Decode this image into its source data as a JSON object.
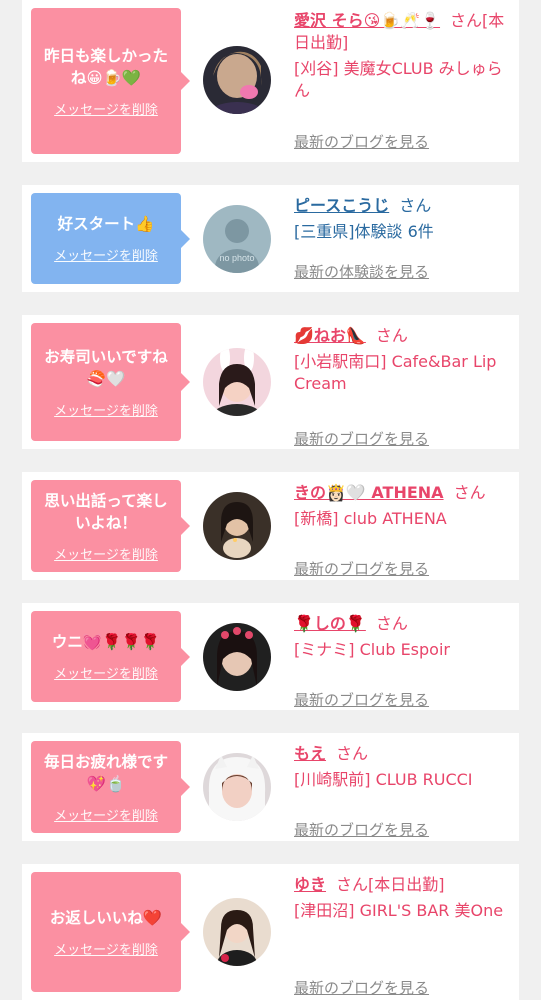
{
  "colors": {
    "pink_bubble": "#fb90a2",
    "blue_bubble": "#82b4f0",
    "pink_text": "#e8456a",
    "blue_text": "#2a6aa0",
    "link_gray": "#8a8a8a"
  },
  "delete_label": "メッセージを削除",
  "cards": [
    {
      "bubble_text": "昨日も楽しかったね😀🍺💚",
      "bubble_color": "pink",
      "avatar": "avatar-photo",
      "name": "愛沢 そら😘🍺🥂🍷",
      "san": "さん",
      "name_suffix": "[本日出勤]",
      "shop": "[刈谷] 美魔女CLUB みしゅらん",
      "blog_link": "最新のブログを見る"
    },
    {
      "bubble_text": "好スタート👍",
      "bubble_color": "blue",
      "avatar": "no-photo-avatar",
      "avatar_text": "no photo",
      "name": "ピースこうじ",
      "san": "さん",
      "name_suffix": "",
      "shop": "[三重県]体験談 6件",
      "blog_link": "最新の体験談を見る"
    },
    {
      "bubble_text": "お寿司いいですね🍣🤍",
      "bubble_color": "pink",
      "avatar": "avatar-photo",
      "name": "💋ねお👠",
      "san": "さん",
      "name_suffix": "",
      "shop": "[小岩駅南口] Cafe&Bar Lip Cream",
      "blog_link": "最新のブログを見る"
    },
    {
      "bubble_text": "思い出話って楽しいよね！",
      "bubble_color": "pink",
      "avatar": "avatar-photo",
      "name": "きの👸🏻🤍 ATHENA",
      "san": "さん",
      "name_suffix": "",
      "shop": "[新橋] club ATHENA",
      "blog_link": "最新のブログを見る"
    },
    {
      "bubble_text": "ウニ💓🌹🌹🌹",
      "bubble_color": "pink",
      "avatar": "avatar-photo",
      "name": "🌹しの🌹",
      "san": "さん",
      "name_suffix": "",
      "shop": "[ミナミ] Club Espoir",
      "blog_link": "最新のブログを見る"
    },
    {
      "bubble_text": "毎日お疲れ様です💖🍵",
      "bubble_color": "pink",
      "avatar": "avatar-photo",
      "name": "もえ",
      "san": "さん",
      "name_suffix": "",
      "shop": "[川崎駅前] CLUB RUCCI",
      "blog_link": "最新のブログを見る"
    },
    {
      "bubble_text": "お返しいいね❤️",
      "bubble_color": "pink",
      "avatar": "avatar-photo",
      "name": "ゆき",
      "san": "さん",
      "name_suffix": "[本日出勤]",
      "shop": "[津田沼] GIRL'S BAR 美One",
      "blog_link": "最新のブログを見る"
    }
  ]
}
